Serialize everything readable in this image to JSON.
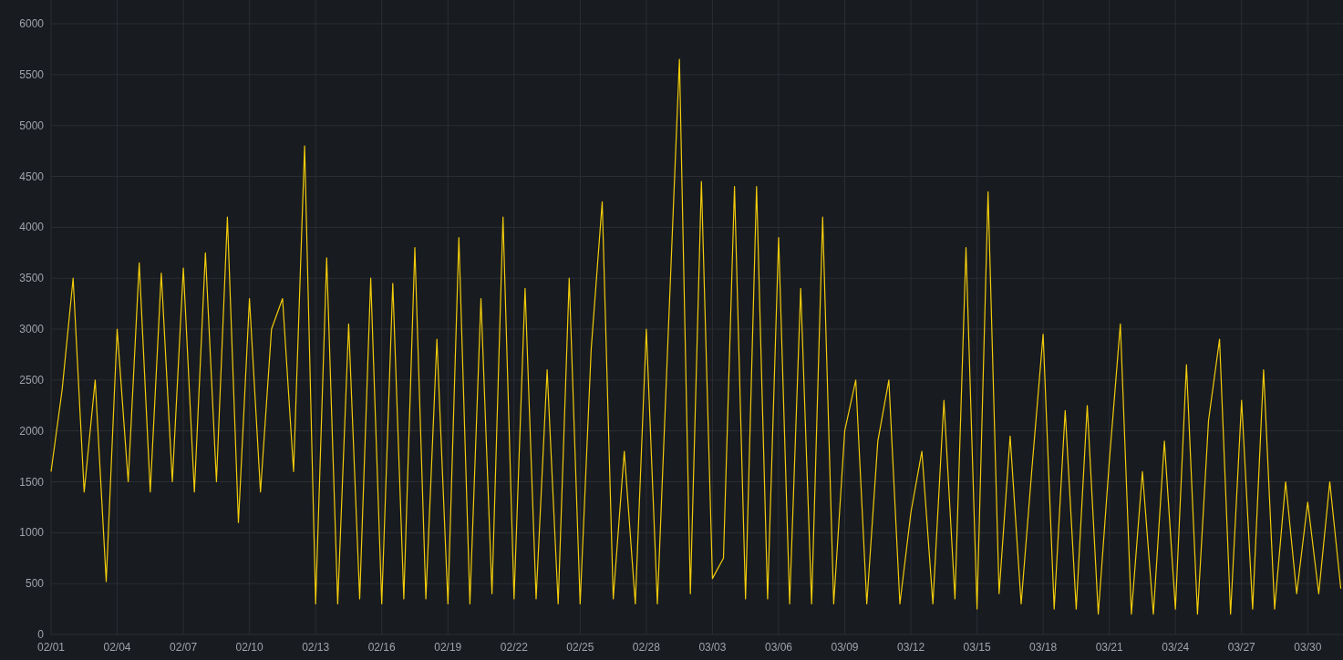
{
  "panel": {
    "chart_data": {
      "type": "line",
      "categories": [
        "02/01",
        null,
        null,
        null,
        null,
        null,
        "02/04",
        null,
        null,
        null,
        null,
        null,
        "02/07",
        null,
        null,
        null,
        null,
        null,
        "02/10",
        null,
        null,
        null,
        null,
        null,
        "02/13",
        null,
        null,
        null,
        null,
        null,
        "02/16",
        null,
        null,
        null,
        null,
        null,
        "02/19",
        null,
        null,
        null,
        null,
        null,
        "02/22",
        null,
        null,
        null,
        null,
        null,
        "02/25",
        null,
        null,
        null,
        null,
        null,
        "02/28",
        null,
        null,
        null,
        null,
        null,
        "03/03",
        null,
        null,
        null,
        null,
        null,
        "03/06",
        null,
        null,
        null,
        null,
        null,
        "03/09",
        null,
        null,
        null,
        null,
        null,
        "03/12",
        null,
        null,
        null,
        null,
        null,
        "03/15",
        null,
        null,
        null,
        null,
        null,
        "03/18",
        null,
        null,
        null,
        null,
        null,
        "03/21",
        null,
        null,
        null,
        null,
        null,
        "03/24",
        null,
        null,
        null,
        null,
        null,
        "03/27",
        null,
        null,
        null,
        null,
        null,
        "03/30",
        null,
        null,
        null
      ],
      "series": [
        {
          "color": "#f2cc0c",
          "values": [
            1600,
            2400,
            3500,
            1400,
            2500,
            520,
            3000,
            1500,
            3650,
            1400,
            3550,
            1500,
            3600,
            1400,
            3750,
            1500,
            4100,
            1100,
            3300,
            1400,
            3000,
            3300,
            1600,
            4800,
            300,
            3700,
            300,
            3050,
            350,
            3500,
            300,
            3450,
            350,
            3800,
            350,
            2900,
            300,
            3900,
            300,
            3300,
            400,
            4100,
            350,
            3400,
            350,
            2600,
            300,
            3500,
            300,
            2800,
            4250,
            350,
            1800,
            300,
            3000,
            300,
            3000,
            5650,
            400,
            4450,
            550,
            750,
            4400,
            350,
            4400,
            350,
            3900,
            300,
            3400,
            300,
            4100,
            300,
            2000,
            2500,
            300,
            1900,
            2500,
            300,
            1200,
            1800,
            300,
            2300,
            350,
            3800,
            250,
            4350,
            400,
            1950,
            300,
            1650,
            2950,
            250,
            2200,
            250,
            2250,
            200,
            1700,
            3050,
            200,
            1600,
            200,
            1900,
            250,
            2650,
            200,
            2100,
            2900,
            200,
            2300,
            250,
            2600,
            250,
            1500,
            400,
            1300,
            400,
            1500,
            450
          ]
        }
      ],
      "ylim": [
        0,
        6000
      ],
      "grid": true,
      "yticks": [
        0,
        500,
        1000,
        1500,
        2000,
        2500,
        3000,
        3500,
        4000,
        4500,
        5000,
        5500,
        6000
      ]
    }
  }
}
